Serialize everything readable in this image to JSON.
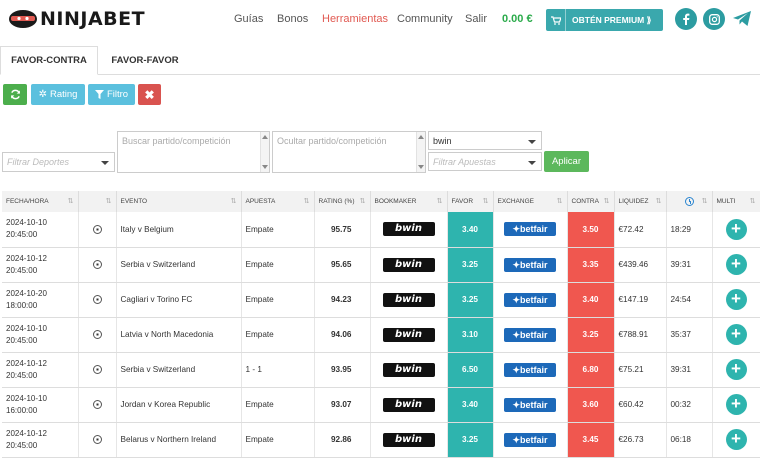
{
  "header": {
    "logo": "NINJABET",
    "nav": [
      {
        "label": "Guías",
        "active": false
      },
      {
        "label": "Bonos",
        "active": false
      },
      {
        "label": "Herramientas",
        "active": true
      },
      {
        "label": "Community",
        "active": false
      },
      {
        "label": "Salir",
        "active": false
      }
    ],
    "balance": "0.00 €",
    "premium_label": "OBTÉN PREMIUM ⟫",
    "social": [
      "facebook-icon",
      "instagram-icon",
      "telegram-icon"
    ],
    "accent_color": "#3aa8ad"
  },
  "tabs": [
    {
      "label": "FAVOR-CONTRA",
      "active": true
    },
    {
      "label": "FAVOR-FAVOR",
      "active": false
    }
  ],
  "toolbar": {
    "refresh_icon": "refresh-icon",
    "rating_label": "Rating",
    "filter_label": "Filtro",
    "clear_icon": "close-icon"
  },
  "filters": {
    "sports_placeholder": "Filtrar Deportes",
    "search_placeholder": "Buscar partido/competición",
    "hide_placeholder": "Ocultar partido/competición",
    "bookmaker_value": "bwin",
    "bets_placeholder": "Filtrar Apuestas",
    "apply_label": "Aplicar"
  },
  "table": {
    "columns": [
      "FECHA/HORA",
      "",
      "EVENTO",
      "APUESTA",
      "RATING (%)",
      "BOOKMAKER",
      "FAVOR",
      "EXCHANGE",
      "CONTRA",
      "LIQUIDEZ",
      "",
      "MULTI"
    ],
    "rows": [
      {
        "date": "2024-10-10",
        "time": "20:45:00",
        "event": "Italy v Belgium",
        "bet": "Empate",
        "rating": "95.75",
        "bookmaker": "bwin",
        "favor": "3.40",
        "exchange": "betfair",
        "contra": "3.50",
        "liquidity": "€72.42",
        "countdown": "18:29"
      },
      {
        "date": "2024-10-12",
        "time": "20:45:00",
        "event": "Serbia v Switzerland",
        "bet": "Empate",
        "rating": "95.65",
        "bookmaker": "bwin",
        "favor": "3.25",
        "exchange": "betfair",
        "contra": "3.35",
        "liquidity": "€439.46",
        "countdown": "39:31"
      },
      {
        "date": "2024-10-20",
        "time": "18:00:00",
        "event": "Cagliari v Torino FC",
        "bet": "Empate",
        "rating": "94.23",
        "bookmaker": "bwin",
        "favor": "3.25",
        "exchange": "betfair",
        "contra": "3.40",
        "liquidity": "€147.19",
        "countdown": "24:54"
      },
      {
        "date": "2024-10-10",
        "time": "20:45:00",
        "event": "Latvia v North Macedonia",
        "bet": "Empate",
        "rating": "94.06",
        "bookmaker": "bwin",
        "favor": "3.10",
        "exchange": "betfair",
        "contra": "3.25",
        "liquidity": "€788.91",
        "countdown": "35:37"
      },
      {
        "date": "2024-10-12",
        "time": "20:45:00",
        "event": "Serbia v Switzerland",
        "bet": "1 - 1",
        "rating": "93.95",
        "bookmaker": "bwin",
        "favor": "6.50",
        "exchange": "betfair",
        "contra": "6.80",
        "liquidity": "€75.21",
        "countdown": "39:31"
      },
      {
        "date": "2024-10-10",
        "time": "16:00:00",
        "event": "Jordan v Korea Republic",
        "bet": "Empate",
        "rating": "93.07",
        "bookmaker": "bwin",
        "favor": "3.40",
        "exchange": "betfair",
        "contra": "3.60",
        "liquidity": "€60.42",
        "countdown": "00:32"
      },
      {
        "date": "2024-10-12",
        "time": "20:45:00",
        "event": "Belarus v Northern Ireland",
        "bet": "Empate",
        "rating": "92.86",
        "bookmaker": "bwin",
        "favor": "3.25",
        "exchange": "betfair",
        "contra": "3.45",
        "liquidity": "€26.73",
        "countdown": "06:18"
      }
    ],
    "favor_color": "#2eb4ae",
    "contra_color": "#f0574f"
  }
}
